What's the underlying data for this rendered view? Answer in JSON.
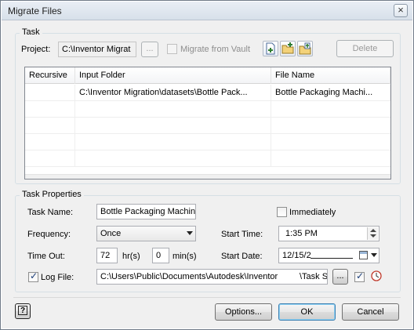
{
  "window": {
    "title": "Migrate Files",
    "close_glyph": "×"
  },
  "task": {
    "group_label": "Task",
    "project_label": "Project:",
    "project_value": "C:\\Inventor Migrat",
    "browse_label": "...",
    "migrate_from_vault_label": "Migrate from Vault",
    "migrate_from_vault_checked": false,
    "toolbar_icons": [
      "add-file-icon",
      "add-folder-icon",
      "add-folder-files-icon"
    ],
    "delete_label": "Delete"
  },
  "table": {
    "columns": [
      "Recursive",
      "Input Folder",
      "File Name"
    ],
    "rows": [
      {
        "recursive": "",
        "input_folder": "C:\\Inventor Migration\\datasets\\Bottle Pack...",
        "file_name": "Bottle Packaging Machi..."
      }
    ]
  },
  "properties": {
    "group_label": "Task Properties",
    "task_name_label": "Task Name:",
    "task_name_value": "Bottle Packaging Machine",
    "immediately_label": "Immediately",
    "immediately_checked": false,
    "frequency_label": "Frequency:",
    "frequency_value": "Once",
    "start_time_label": "Start Time:",
    "start_time_value": "1:35 PM",
    "time_out_label": "Time Out:",
    "timeout_hours": "72",
    "hours_unit": "hr(s)",
    "timeout_minutes": "0",
    "minutes_unit": "min(s)",
    "start_date_label": "Start Date:",
    "start_date_value": "12/15/2",
    "log_file_label": "Log File:",
    "log_file_checked": true,
    "log_file_value": "C:\\Users\\Public\\Documents\\Autodesk\\Inventor",
    "log_file_suffix": "\\Task S",
    "log_browse_label": "..."
  },
  "footer": {
    "help_icon": "help-icon",
    "options_label": "Options...",
    "ok_label": "OK",
    "cancel_label": "Cancel"
  },
  "colors": {
    "accent": "#3c7fb1",
    "window_bg": "#f0f0f0"
  }
}
